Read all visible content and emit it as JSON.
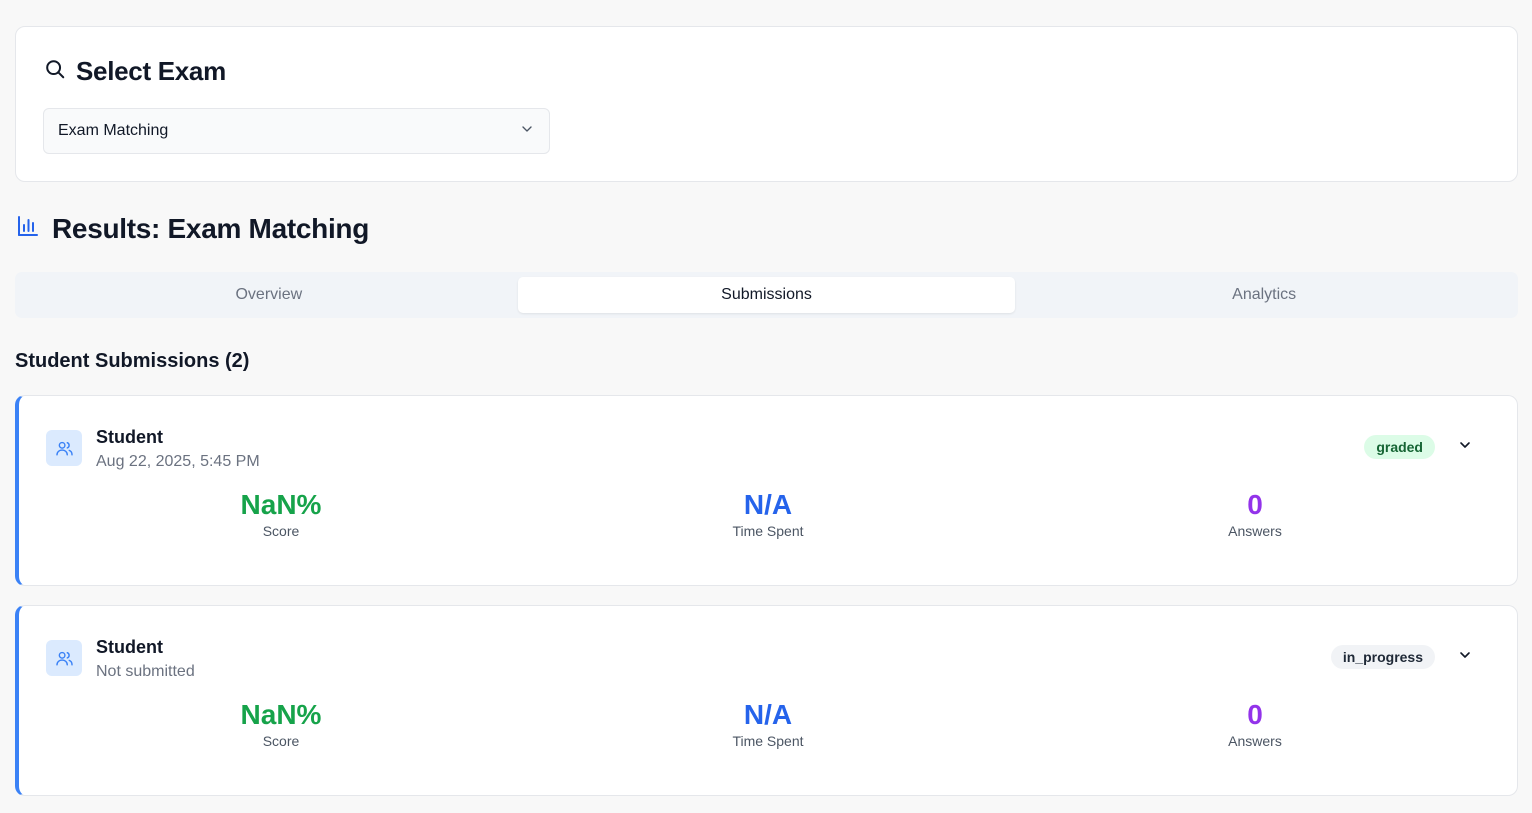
{
  "selector": {
    "title": "Select Exam",
    "selected_exam": "Exam Matching"
  },
  "results": {
    "title": "Results: Exam Matching"
  },
  "tabs": [
    {
      "label": "Overview"
    },
    {
      "label": "Submissions"
    },
    {
      "label": "Analytics"
    }
  ],
  "submissions": {
    "heading": "Student Submissions (2)",
    "items": [
      {
        "student": "Student",
        "date": "Aug 22, 2025, 5:45 PM",
        "status": "graded",
        "score": "NaN%",
        "score_label": "Score",
        "time_spent": "N/A",
        "time_label": "Time Spent",
        "answers": "0",
        "answers_label": "Answers"
      },
      {
        "student": "Student",
        "date": "Not submitted",
        "status": "in_progress",
        "score": "NaN%",
        "score_label": "Score",
        "time_spent": "N/A",
        "time_label": "Time Spent",
        "answers": "0",
        "answers_label": "Answers"
      }
    ]
  },
  "icons": {
    "selector": "search-icon",
    "results": "bar-chart-icon",
    "avatar": "users-icon",
    "dropdown": "chevron-down-icon",
    "expand": "chevron-down-icon"
  },
  "colors": {
    "accent": "#3b82f6",
    "score": "#16a34a",
    "time": "#2563eb",
    "answers": "#9333ea",
    "graded_bg": "#dcfce7",
    "graded_text": "#166534",
    "in_progress_bg": "#f1f3f6"
  }
}
